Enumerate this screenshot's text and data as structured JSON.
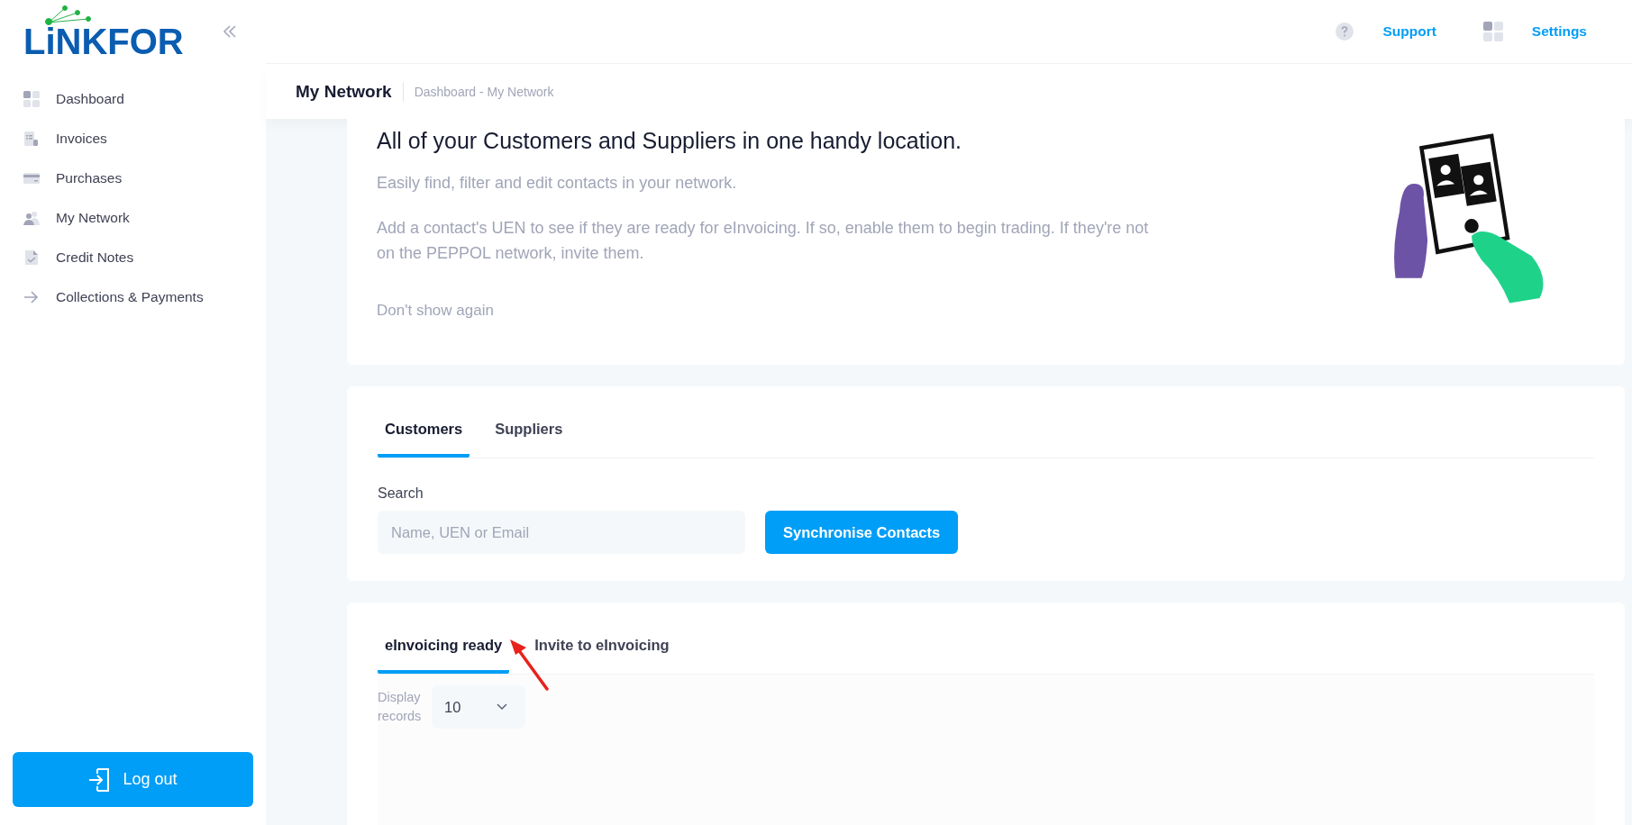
{
  "sidebar": {
    "logo": "LiNKFOR",
    "items": [
      {
        "label": "Dashboard",
        "kind": "grid",
        "selected": false
      },
      {
        "label": "Invoices",
        "kind": "invoice",
        "selected": false
      },
      {
        "label": "Purchases",
        "kind": "card",
        "selected": false
      },
      {
        "label": "My Network",
        "kind": "people",
        "selected": false
      },
      {
        "label": "Credit Notes",
        "kind": "note",
        "selected": false
      },
      {
        "label": "Collections & Payments",
        "kind": "arrow",
        "selected": false
      }
    ],
    "logout": "Log out"
  },
  "topbar": {
    "links": [
      {
        "label": "Support",
        "kind": "help"
      },
      {
        "label": "Settings",
        "kind": "grid"
      }
    ]
  },
  "page_header": {
    "title": "My Network",
    "breadcrumb": "Dashboard - My Network"
  },
  "intro": {
    "heading": "All of your Customers and Suppliers in one handy location.",
    "paragraphs": [
      "Easily find, filter and edit contacts in your network.",
      "Add a contact's UEN to see if they are ready for eInvoicing. If so, enable them to begin trading. If they're not on the PEPPOL network, invite them."
    ],
    "dismiss": "Don't show again"
  },
  "contact_tabs": [
    {
      "label": "Customers",
      "selected": true
    },
    {
      "label": "Suppliers",
      "selected": false
    }
  ],
  "search": {
    "label": "Search",
    "placeholder": "Name, UEN or Email"
  },
  "sync_button": "Synchronise Contacts",
  "status_tabs": [
    {
      "label": "eInvoicing ready",
      "selected": true
    },
    {
      "label": "Invite to eInvoicing",
      "selected": false
    }
  ],
  "records": {
    "label": "Display records",
    "value": "10"
  }
}
